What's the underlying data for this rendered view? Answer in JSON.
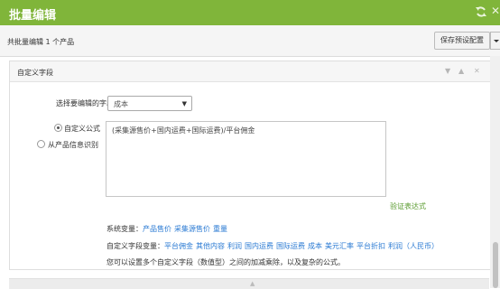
{
  "window": {
    "title": "批量编辑",
    "refresh_icon": "refresh-icon",
    "close_icon": "close-icon",
    "close_glyph": "✕"
  },
  "toolbar": {
    "count_text": "共批量编辑 1 个产品",
    "save_preset_label": "保存预设配置"
  },
  "panel": {
    "title": "自定义字段",
    "controls": {
      "collapse": "▼",
      "expand": "▲",
      "close": "✕"
    },
    "field_label": "选择要编辑的字段",
    "field_select": {
      "value": "成本",
      "caret": "▼"
    },
    "options": [
      {
        "label": "自定义公式",
        "selected": true
      },
      {
        "label": "从产品信息识别",
        "selected": false
      }
    ],
    "formula": "(采集源售价+国内运费+国际运费)/平台佣金",
    "verify_link": "验证表达式",
    "system_vars": {
      "label": "系统变量：",
      "items": [
        "产品售价",
        "采集源售价",
        "重量"
      ]
    },
    "custom_vars": {
      "label": "自定义字段变量：",
      "items": [
        "平台佣金",
        "其他内容",
        "利润",
        "国内运费",
        "国际运费",
        "成本",
        "美元汇率",
        "平台折扣",
        "利润（人民币）"
      ]
    },
    "hint": "您可以设置多个自定义字段（数值型）之间的加减乘除，以及复杂的公式。"
  },
  "colors": {
    "header_bg": "#80b53a",
    "link": "#2a7ad3",
    "verify": "#5a9b2f"
  }
}
